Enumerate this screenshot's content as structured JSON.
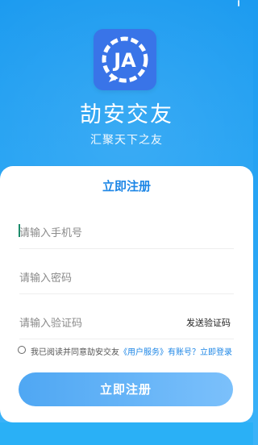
{
  "header": {
    "app_name": "劼安交友",
    "slogan": "汇聚天下之友",
    "logo_icon": "chat-ja-logo-icon",
    "logo_text": "JA"
  },
  "form": {
    "title": "立即注册",
    "phone": {
      "placeholder": "请输入手机号",
      "value": ""
    },
    "password": {
      "placeholder": "请输入密码",
      "value": ""
    },
    "code": {
      "placeholder": "请输入验证码",
      "value": "",
      "send_label": "发送验证码"
    },
    "agreement": {
      "prefix": "我已阅读并同意劼安交友",
      "service_link": "《用户服务》",
      "have_account": "有账号？",
      "login_link": "立即登录",
      "checked": false
    },
    "submit_label": "立即注册"
  },
  "colors": {
    "primary": "#1d86e6",
    "bg_gradient_top": "#1c9bf0",
    "button_gradient_from": "#4fa7f3",
    "button_gradient_to": "#7bc0fb",
    "logo_bg": "#3974e8"
  }
}
